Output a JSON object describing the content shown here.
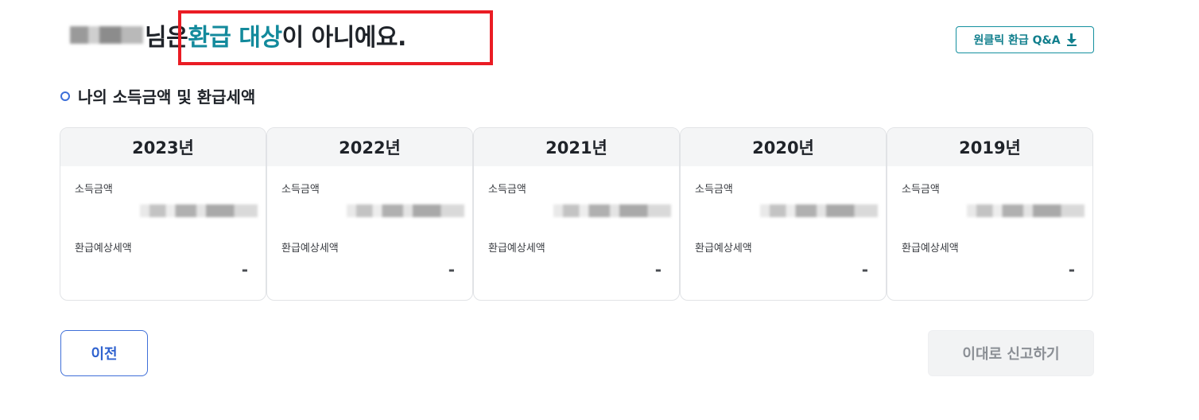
{
  "heading": {
    "suffix_before": "님은 ",
    "accent": "환급 대상",
    "suffix_after": "이 아니에요."
  },
  "qa_button": {
    "label": "원클릭 환급 Q&A",
    "icon": "download-icon"
  },
  "section": {
    "title": "나의 소득금액 및 환급세액",
    "icon": "ring-bullet-icon"
  },
  "cards": [
    {
      "year": "2023년",
      "income_label": "소득금액",
      "refund_label": "환급예상세액",
      "refund_value": "-"
    },
    {
      "year": "2022년",
      "income_label": "소득금액",
      "refund_label": "환급예상세액",
      "refund_value": "-"
    },
    {
      "year": "2021년",
      "income_label": "소득금액",
      "refund_label": "환급예상세액",
      "refund_value": "-"
    },
    {
      "year": "2020년",
      "income_label": "소득금액",
      "refund_label": "환급예상세액",
      "refund_value": "-"
    },
    {
      "year": "2019년",
      "income_label": "소득금액",
      "refund_label": "환급예상세액",
      "refund_value": "-"
    }
  ],
  "buttons": {
    "prev": "이전",
    "report": "이대로 신고하기"
  },
  "colors": {
    "accent": "#138a9c",
    "highlight": "#ea1c24",
    "primary_blue": "#3f6fd8"
  }
}
